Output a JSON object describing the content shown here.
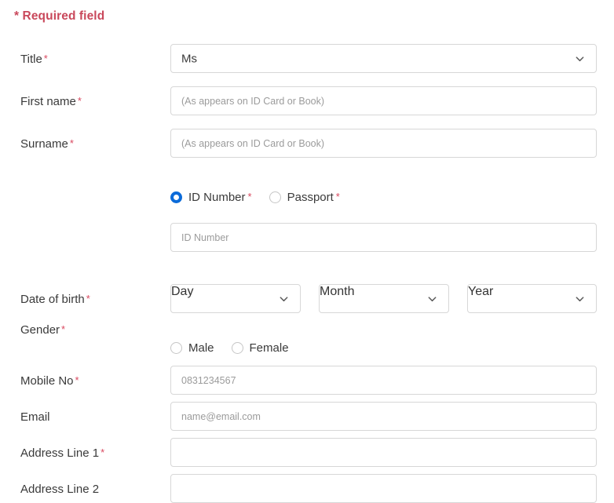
{
  "notice": {
    "text": "* Required field",
    "color": "#c9485b"
  },
  "colors": {
    "accent_blue": "#0b6bd9",
    "required_red": "#d9485f",
    "label_text": "#3a3a3a",
    "placeholder_text": "#9b9b9b",
    "border": "#d7d7d7",
    "background": "#ffffff"
  },
  "form": {
    "title": {
      "label": "Title",
      "required_mark": "*",
      "selected_value": "Ms",
      "chevron_icon": "chevron-down-icon"
    },
    "first_name": {
      "label": "First name",
      "required_mark": "*",
      "placeholder": "(As appears on ID Card or Book)",
      "value": ""
    },
    "surname": {
      "label": "Surname",
      "required_mark": "*",
      "placeholder": "(As appears on ID Card or Book)",
      "value": ""
    },
    "identification": {
      "options": [
        {
          "label": "ID Number",
          "required_mark": "*",
          "selected": true
        },
        {
          "label": "Passport",
          "required_mark": "*",
          "selected": false
        }
      ],
      "input": {
        "placeholder": "ID Number",
        "value": ""
      }
    },
    "date_of_birth": {
      "label": "Date of birth",
      "required_mark": "*",
      "day": {
        "selected_value": "Day",
        "chevron_icon": "chevron-down-icon"
      },
      "month": {
        "selected_value": "Month",
        "chevron_icon": "chevron-down-icon"
      },
      "year": {
        "selected_value": "Year",
        "chevron_icon": "chevron-down-icon"
      }
    },
    "gender": {
      "label": "Gender",
      "required_mark": "*",
      "options": [
        {
          "label": "Male",
          "selected": false
        },
        {
          "label": "Female",
          "selected": false
        }
      ]
    },
    "mobile_no": {
      "label": "Mobile No",
      "required_mark": "*",
      "placeholder": "0831234567",
      "value": ""
    },
    "email": {
      "label": "Email",
      "required_mark": "",
      "placeholder": "name@email.com",
      "value": ""
    },
    "address_line_1": {
      "label": "Address Line 1",
      "required_mark": "*",
      "placeholder": "",
      "value": ""
    },
    "address_line_2": {
      "label": "Address Line 2",
      "required_mark": "",
      "placeholder": "",
      "value": ""
    }
  }
}
